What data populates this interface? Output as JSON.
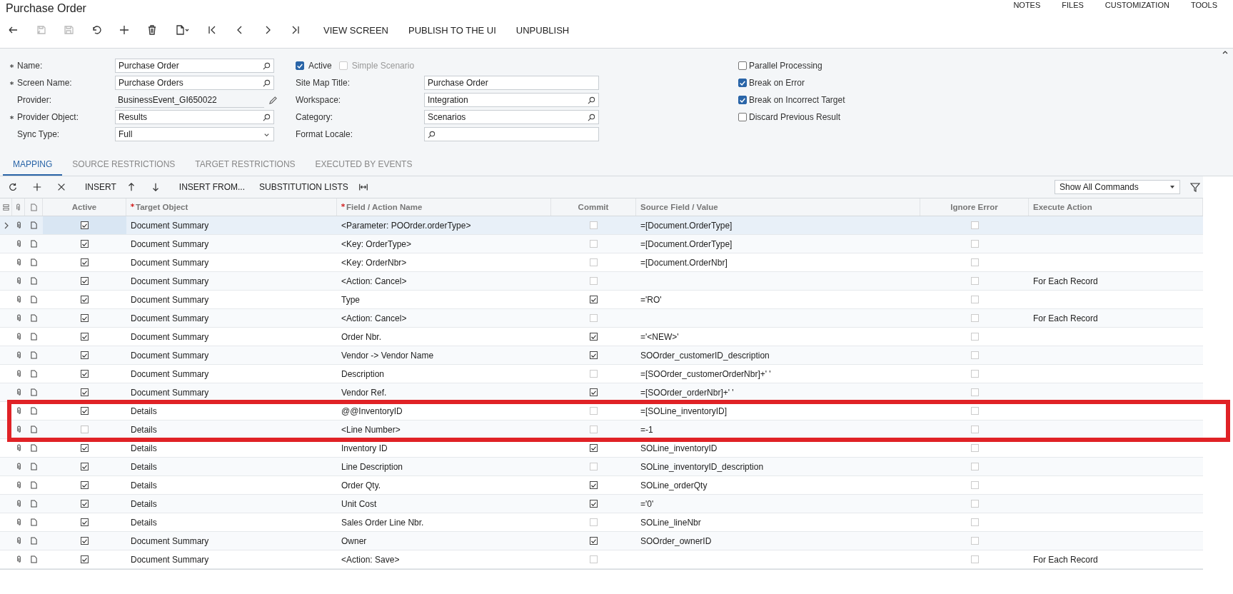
{
  "header": {
    "title": "Purchase Order",
    "top_links": [
      "NOTES",
      "FILES",
      "CUSTOMIZATION",
      "TOOLS"
    ]
  },
  "toolbar": {
    "icon_buttons": [
      {
        "disabled": false
      },
      {
        "disabled": true
      },
      {
        "disabled": true
      },
      {
        "disabled": false
      },
      {
        "disabled": false
      },
      {
        "disabled": false
      },
      {
        "disabled": false
      },
      {
        "disabled": false
      },
      {
        "disabled": false
      },
      {
        "disabled": false
      },
      {
        "disabled": false
      }
    ],
    "buttons": [
      "VIEW SCREEN",
      "PUBLISH TO THE UI",
      "UNPUBLISH"
    ]
  },
  "form": {
    "left_fields": [
      {
        "label": "Name:",
        "required": true,
        "value": "Purchase Order",
        "kind": "lookup"
      },
      {
        "label": "Screen Name:",
        "required": true,
        "value": "Purchase Orders",
        "kind": "lookup"
      },
      {
        "label": "Provider:",
        "required": false,
        "value": "BusinessEvent_GI650022",
        "kind": "readonly"
      },
      {
        "label": "Provider Object:",
        "required": true,
        "value": "Results",
        "kind": "lookup"
      },
      {
        "label": "Sync Type:",
        "required": false,
        "value": "Full",
        "kind": "select"
      }
    ],
    "middle_checkboxes": [
      {
        "label": "Active",
        "checked": true,
        "disabled": false
      },
      {
        "label": "Simple Scenario",
        "checked": false,
        "disabled": true
      }
    ],
    "middle_fields": [
      {
        "label": "Site Map Title:",
        "value": "Purchase Order",
        "kind": "text"
      },
      {
        "label": "Workspace:",
        "value": "Integration",
        "kind": "lookup"
      },
      {
        "label": "Category:",
        "value": "Scenarios",
        "kind": "lookup"
      },
      {
        "label": "Format Locale:",
        "kind": "lookup"
      }
    ],
    "right_checkboxes": [
      {
        "label": "Parallel Processing",
        "checked": false
      },
      {
        "label": "Break on Error",
        "checked": true
      },
      {
        "label": "Break on Incorrect Target",
        "checked": true
      },
      {
        "label": "Discard Previous Result",
        "checked": false
      }
    ]
  },
  "tabs": [
    {
      "label": "MAPPING",
      "selected": true
    },
    {
      "label": "SOURCE RESTRICTIONS",
      "selected": false
    },
    {
      "label": "TARGET RESTRICTIONS",
      "selected": false
    },
    {
      "label": "EXECUTED BY EVENTS",
      "selected": false
    }
  ],
  "grid_toolbar": {
    "items": [
      {
        "kind": "icon"
      },
      {
        "kind": "icon"
      },
      {
        "kind": "icon"
      },
      {
        "kind": "text",
        "label": "INSERT"
      },
      {
        "kind": "icon"
      },
      {
        "kind": "icon"
      },
      {
        "kind": "text",
        "label": "INSERT FROM..."
      },
      {
        "kind": "text",
        "label": "SUBSTITUTION LISTS"
      },
      {
        "kind": "icon"
      }
    ],
    "filter_select": "Show All Commands"
  },
  "table": {
    "columns": [
      {
        "label": "Active",
        "required": false
      },
      {
        "label": "Target Object",
        "required": true
      },
      {
        "label": "Field / Action Name",
        "required": true
      },
      {
        "label": "Commit",
        "required": false
      },
      {
        "label": "Source Field / Value",
        "required": false
      },
      {
        "label": "Ignore Error",
        "required": false
      },
      {
        "label": "Execute Action",
        "required": false
      }
    ],
    "rows": [
      {
        "selected": true,
        "highlighted": false,
        "active": true,
        "target": "Document Summary",
        "field": "<Parameter: POOrder.orderType>",
        "commit": false,
        "source": "=[Document.OrderType]",
        "ignore_error": false
      },
      {
        "selected": false,
        "highlighted": false,
        "active": true,
        "target": "Document Summary",
        "field": "<Key: OrderType>",
        "commit": false,
        "source": "=[Document.OrderType]",
        "ignore_error": false
      },
      {
        "selected": false,
        "highlighted": false,
        "active": true,
        "target": "Document Summary",
        "field": "<Key: OrderNbr>",
        "commit": false,
        "source": "=[Document.OrderNbr]",
        "ignore_error": false
      },
      {
        "selected": false,
        "highlighted": false,
        "active": true,
        "target": "Document Summary",
        "field": "<Action: Cancel>",
        "commit": false,
        "ignore_error": false,
        "execute_action": "For Each Record"
      },
      {
        "selected": false,
        "highlighted": false,
        "active": true,
        "target": "Document Summary",
        "field": "Type",
        "commit": true,
        "source": "='RO'",
        "ignore_error": false
      },
      {
        "selected": false,
        "highlighted": false,
        "active": true,
        "target": "Document Summary",
        "field": "<Action: Cancel>",
        "commit": false,
        "ignore_error": false,
        "execute_action": "For Each Record"
      },
      {
        "selected": false,
        "highlighted": false,
        "active": true,
        "target": "Document Summary",
        "field": "Order Nbr.",
        "commit": true,
        "source": "='<NEW>'",
        "ignore_error": false
      },
      {
        "selected": false,
        "highlighted": false,
        "active": true,
        "target": "Document Summary",
        "field": "Vendor -> Vendor Name",
        "commit": true,
        "source": "SOOrder_customerID_description",
        "ignore_error": false
      },
      {
        "selected": false,
        "highlighted": false,
        "active": true,
        "target": "Document Summary",
        "field": "Description",
        "commit": false,
        "source": "=[SOOrder_customerOrderNbr]+' '",
        "ignore_error": false
      },
      {
        "selected": false,
        "highlighted": false,
        "active": true,
        "target": "Document Summary",
        "field": "Vendor Ref.",
        "commit": true,
        "source": "=[SOOrder_orderNbr]+' '",
        "ignore_error": false
      },
      {
        "selected": false,
        "highlighted": true,
        "active": true,
        "target": "Details",
        "field": "@@InventoryID",
        "commit": false,
        "source": "=[SOLine_inventoryID]",
        "ignore_error": false
      },
      {
        "selected": false,
        "highlighted": true,
        "active": false,
        "target": "Details",
        "field": "<Line Number>",
        "commit": false,
        "source": "=-1",
        "ignore_error": false
      },
      {
        "selected": false,
        "highlighted": false,
        "active": true,
        "target": "Details",
        "field": "Inventory ID",
        "commit": true,
        "source": "SOLine_inventoryID",
        "ignore_error": false
      },
      {
        "selected": false,
        "highlighted": false,
        "active": true,
        "target": "Details",
        "field": "Line Description",
        "commit": false,
        "source": "SOLine_inventoryID_description",
        "ignore_error": false
      },
      {
        "selected": false,
        "highlighted": false,
        "active": true,
        "target": "Details",
        "field": "Order Qty.",
        "commit": true,
        "source": "SOLine_orderQty",
        "ignore_error": false
      },
      {
        "selected": false,
        "highlighted": false,
        "active": true,
        "target": "Details",
        "field": "Unit Cost",
        "commit": true,
        "source": "='0'",
        "ignore_error": false
      },
      {
        "selected": false,
        "highlighted": false,
        "active": true,
        "target": "Details",
        "field": "Sales Order Line Nbr.",
        "commit": false,
        "source": "SOLine_lineNbr",
        "ignore_error": false
      },
      {
        "selected": false,
        "highlighted": false,
        "active": true,
        "target": "Document Summary",
        "field": "Owner",
        "commit": true,
        "source": "SOOrder_ownerID",
        "ignore_error": false
      },
      {
        "selected": false,
        "highlighted": false,
        "active": true,
        "target": "Document Summary",
        "field": "<Action: Save>",
        "commit": false,
        "ignore_error": false,
        "execute_action": "For Each Record"
      }
    ]
  }
}
